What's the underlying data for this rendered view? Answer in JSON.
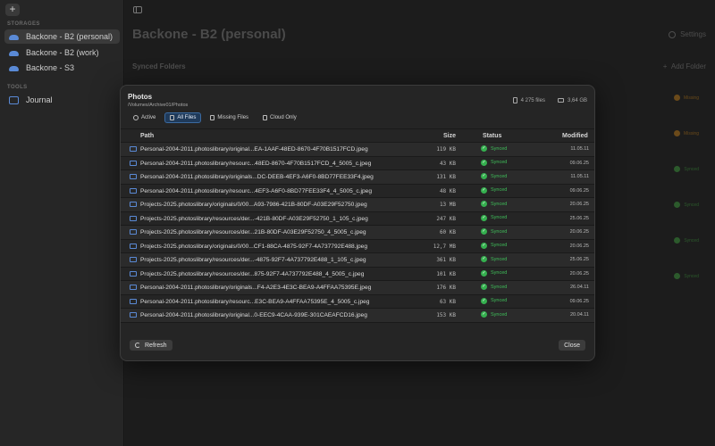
{
  "sidebar": {
    "storages_label": "STORAGES",
    "tools_label": "TOOLS",
    "storages": [
      {
        "label": "Backone - B2 (personal)",
        "icon": "cloud-icon"
      },
      {
        "label": "Backone - B2 (work)",
        "icon": "cloud-icon"
      },
      {
        "label": "Backone - S3",
        "icon": "cloud-icon"
      }
    ],
    "tools": [
      {
        "label": "Journal",
        "icon": "journal-icon"
      }
    ]
  },
  "main": {
    "title": "Backone - B2 (personal)",
    "settings_label": "Settings",
    "synced_folders_label": "Synced Folders",
    "add_folder_label": "Add Folder",
    "folder_statuses": [
      "Missing",
      "Missing",
      "Synced",
      "Synced",
      "Synced",
      "Synced"
    ]
  },
  "modal": {
    "title": "Photos",
    "path": "/Volumes/Archive01/Photos",
    "file_count": "4 275 files",
    "total_size": "3,64 GB",
    "filters": [
      {
        "label": "Active",
        "icon": "clock-icon"
      },
      {
        "label": "All Files",
        "icon": "document-icon"
      },
      {
        "label": "Missing Files",
        "icon": "document-icon"
      },
      {
        "label": "Cloud Only",
        "icon": "document-icon"
      }
    ],
    "active_filter": "All Files",
    "columns": {
      "path": "Path",
      "size": "Size",
      "status": "Status",
      "modified": "Modified"
    },
    "rows": [
      {
        "path": "Personal-2004-2011.photoslibrary/original...EA-1AAF-48ED-8670-4F70B1517FCD.jpeg",
        "size": "119  KB",
        "status": "Synced",
        "modified": "11.05.11"
      },
      {
        "path": "Personal-2004-2011.photoslibrary/resourc...48ED-8670-4F70B1517FCD_4_5005_c.jpeg",
        "size": "43  KB",
        "status": "Synced",
        "modified": "09.06.25"
      },
      {
        "path": "Personal-2004-2011.photoslibrary/originals...DC-DEEB-4EF3-A6F0-8BD77FEE33F4.jpeg",
        "size": "131  KB",
        "status": "Synced",
        "modified": "11.05.11"
      },
      {
        "path": "Personal-2004-2011.photoslibrary/resourc...4EF3-A6F0-8BD77FEE33F4_4_5005_c.jpeg",
        "size": "48  KB",
        "status": "Synced",
        "modified": "09.06.25"
      },
      {
        "path": "Projects-2025.photoslibrary/originals/0/00...A93-7986-421B-80DF-A03E29F52750.jpeg",
        "size": "13  MB",
        "status": "Synced",
        "modified": "20.06.25"
      },
      {
        "path": "Projects-2025.photoslibrary/resources/der...-421B-80DF-A03E29F52750_1_105_c.jpeg",
        "size": "247  KB",
        "status": "Synced",
        "modified": "25.06.25"
      },
      {
        "path": "Projects-2025.photoslibrary/resources/der...21B-80DF-A03E29F52750_4_5005_c.jpeg",
        "size": "60  KB",
        "status": "Synced",
        "modified": "20.06.25"
      },
      {
        "path": "Projects-2025.photoslibrary/originals/0/00...CF1-88CA-4875-92F7-4A737792E488.jpeg",
        "size": "12,7  MB",
        "status": "Synced",
        "modified": "20.06.25"
      },
      {
        "path": "Projects-2025.photoslibrary/resources/der...-4875-92F7-4A737792E488_1_105_c.jpeg",
        "size": "361  KB",
        "status": "Synced",
        "modified": "25.06.25"
      },
      {
        "path": "Projects-2025.photoslibrary/resources/der...875-92F7-4A737792E488_4_5005_c.jpeg",
        "size": "101  KB",
        "status": "Synced",
        "modified": "20.06.25"
      },
      {
        "path": "Personal-2004-2011.photoslibrary/originals...F4-A2E3-4E3C-BEA9-A4FFAA75395E.jpeg",
        "size": "176  KB",
        "status": "Synced",
        "modified": "26.04.11"
      },
      {
        "path": "Personal-2004-2011.photoslibrary/resourc...E3C-BEA9-A4FFAA75395E_4_5005_c.jpeg",
        "size": "63  KB",
        "status": "Synced",
        "modified": "09.06.25"
      },
      {
        "path": "Personal-2004-2011.photoslibrary/original...0-EEC9-4CAA-939E-301CAEAFCD16.jpeg",
        "size": "153  KB",
        "status": "Synced",
        "modified": "20.04.11"
      }
    ],
    "refresh_label": "Refresh",
    "close_label": "Close"
  },
  "colors": {
    "accent": "#3b6aa0",
    "synced": "#35b04f",
    "missing": "#c98a2a",
    "background": "#1e1e1e"
  }
}
